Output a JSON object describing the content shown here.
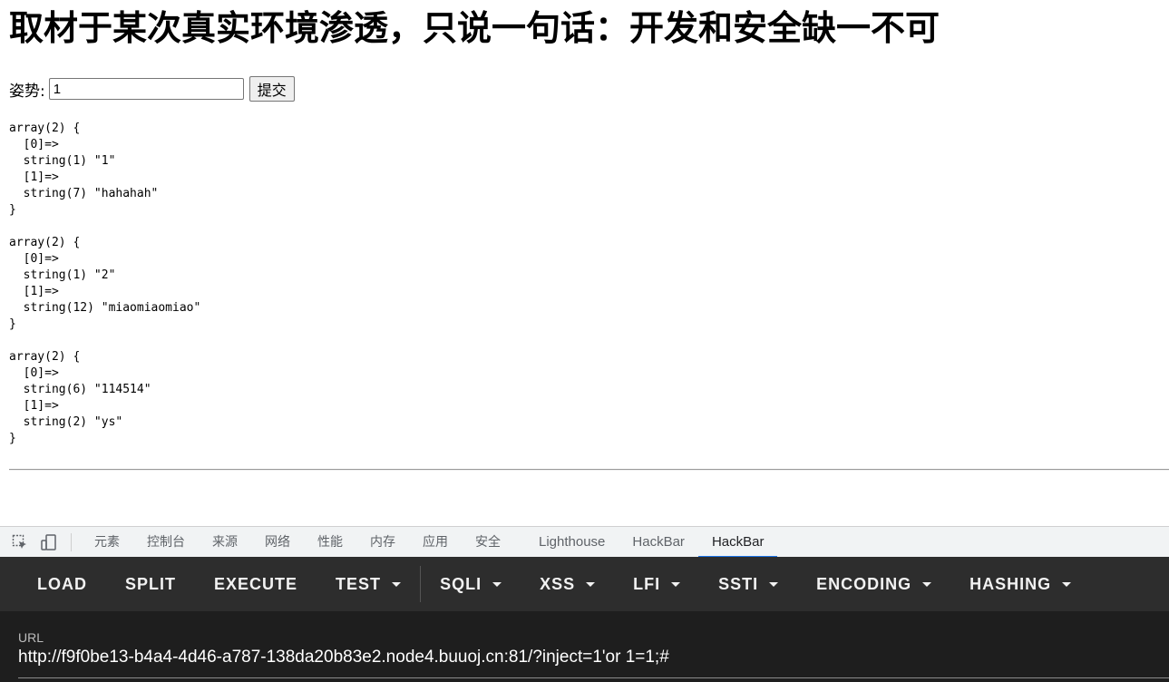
{
  "page": {
    "title": "取材于某次真实环境渗透，只说一句话：开发和安全缺一不可",
    "form": {
      "label": "姿势:",
      "input_value": "1",
      "submit_label": "提交"
    },
    "dumps": [
      "array(2) {\n  [0]=>\n  string(1) \"1\"\n  [1]=>\n  string(7) \"hahahah\"\n}",
      "array(2) {\n  [0]=>\n  string(1) \"2\"\n  [1]=>\n  string(12) \"miaomiaomiao\"\n}",
      "array(2) {\n  [0]=>\n  string(6) \"114514\"\n  [1]=>\n  string(2) \"ys\"\n}"
    ]
  },
  "devtools": {
    "tabs": [
      "元素",
      "控制台",
      "来源",
      "网络",
      "性能",
      "内存",
      "应用",
      "安全",
      "Lighthouse",
      "HackBar",
      "HackBar"
    ],
    "active_tab_index": 10,
    "icons": [
      "inspect-element-icon",
      "device-toolbar-icon"
    ],
    "accent_color": "#1a73e8"
  },
  "hackbar": {
    "buttons": [
      "LOAD",
      "SPLIT",
      "EXECUTE",
      "TEST",
      "SQLI",
      "XSS",
      "LFI",
      "SSTI",
      "ENCODING",
      "HASHING"
    ],
    "url_label": "URL",
    "url_value": "http://f9f0be13-b4a4-4d46-a787-138da20b83e2.node4.buuoj.cn:81/?inject=1'or  1=1;#"
  }
}
